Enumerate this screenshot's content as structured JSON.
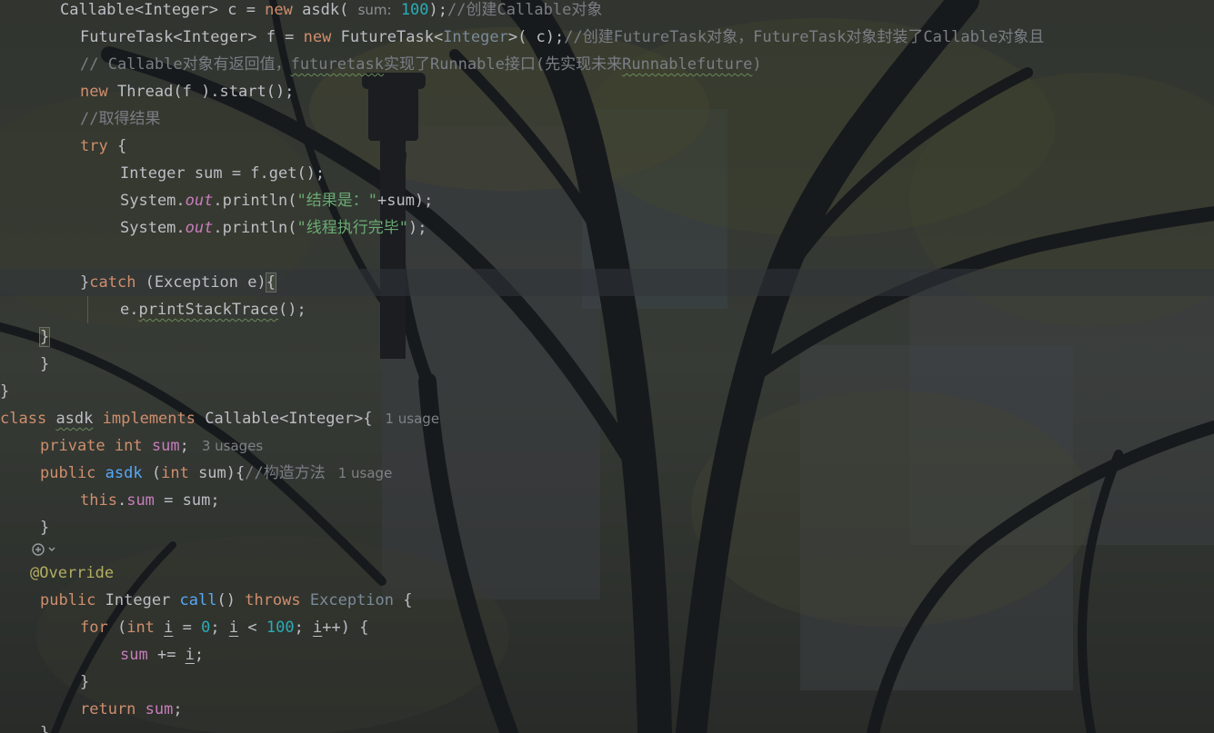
{
  "editor": {
    "lines": [
      {
        "id": "l1"
      },
      {
        "id": "l2"
      }
    ],
    "text": {
      "l1_a": "Callable<Integer> c = ",
      "l1_new": "new",
      "l1_b": " asdk(",
      "l1_hint": "sum:",
      "l1_num": "100",
      "l1_c": ");",
      "l1_cm": "//创建Callable对象",
      "l2_a": "FutureTask<Integer> f = ",
      "l2_new": "new",
      "l2_b": " FutureTask<",
      "l2_gen": "Integer",
      "l2_c": ">( c);",
      "l2_cm": "//创建FutureTask对象，FutureTask对象封装了Callable对象且",
      "l3_cm1": "// Callable对象有返回值，",
      "l3_cm2": "futuretask",
      "l3_cm3": "实现了Runnable接口(先实现未来",
      "l3_cm4": "Runnablefuture",
      "l3_cm5": ")",
      "l4_new": "new",
      "l4_b": " Thread(f ).start();",
      "l5_cm": "//取得结果",
      "l6_try": "try",
      "l6_b": " {",
      "l7_a": "Integer sum = f.get();",
      "l8_a": "System.",
      "l8_out": "out",
      "l8_b": ".println(",
      "l8_str": "\"结果是：\"",
      "l8_c": "+sum);",
      "l9_a": "System.",
      "l9_out": "out",
      "l9_b": ".println(",
      "l9_str": "\"线程执行完毕\"",
      "l9_c": ");",
      "l11_a": "}",
      "l11_catch": "catch",
      "l11_b": " (Exception e)",
      "l11_brace": "{",
      "l12_a": "e.",
      "l12_m": "printStackTrace",
      "l12_b": "();",
      "l13_a": "}",
      "l14_a": "}",
      "l15_a": "}",
      "l16_class": "class",
      "l16_name": "asdk",
      "l16_impl": "implements",
      "l16_b": " Callable<Integer>{",
      "l16_usage": "1 usage",
      "l17_priv": "private",
      "l17_int": "int",
      "l17_sum": "sum",
      "l17_b": ";",
      "l17_usage": "3 usages",
      "l18_pub": "public",
      "l18_name": "asdk",
      "l18_b": " (",
      "l18_int": "int",
      "l18_c": " sum){",
      "l18_cm": "//构造方法",
      "l18_usage": "1 usage",
      "l19_this": "this",
      "l19_dot": ".",
      "l19_sum": "sum",
      "l19_b": " = sum;",
      "l20_a": "}",
      "l21_ann": "@Override",
      "l22_pub": "public",
      "l22_b": " Integer ",
      "l22_call": "call",
      "l22_c": "() ",
      "l22_throws": "throws",
      "l22_exc": "Exception",
      "l22_d": " {",
      "l23_for": "for",
      "l23_b": " (",
      "l23_int": "int",
      "l23_i1": "i",
      "l23_c": " = ",
      "l23_zero": "0",
      "l23_d": "; ",
      "l23_i2": "i",
      "l23_e": " < ",
      "l23_hundred": "100",
      "l23_f": "; ",
      "l23_i3": "i",
      "l23_g": "++) {",
      "l24_sum": "sum",
      "l24_b": " += ",
      "l24_i": "i",
      "l24_c": ";",
      "l25_a": "}",
      "l26_ret": "return",
      "l26_sum": "sum",
      "l26_b": ";",
      "l27_a": "}"
    },
    "gutter_icon": "implement-method-icon"
  }
}
